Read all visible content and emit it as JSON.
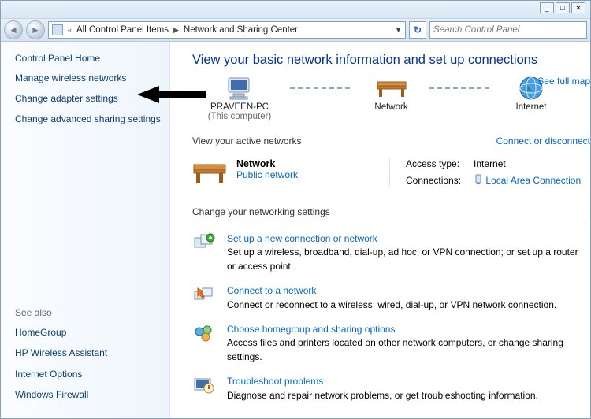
{
  "window_controls": {
    "min": "_",
    "max": "□",
    "close": "✕"
  },
  "breadcrumb": {
    "segment1": "All Control Panel Items",
    "segment2": "Network and Sharing Center"
  },
  "search": {
    "placeholder": "Search Control Panel"
  },
  "sidebar": {
    "home": "Control Panel Home",
    "links": [
      "Manage wireless networks",
      "Change adapter settings",
      "Change advanced sharing settings"
    ],
    "see_also_heading": "See also",
    "see_also": [
      "HomeGroup",
      "HP Wireless Assistant",
      "Internet Options",
      "Windows Firewall"
    ]
  },
  "main": {
    "title": "View your basic network information and set up connections",
    "full_map": "See full map",
    "nodes": {
      "computer": "PRAVEEN-PC",
      "computer_sub": "(This computer)",
      "network": "Network",
      "internet": "Internet"
    },
    "active_hdr": "View your active networks",
    "connect_link": "Connect or disconnect",
    "active": {
      "name": "Network",
      "type": "Public network",
      "access_label": "Access type:",
      "access_value": "Internet",
      "conn_label": "Connections:",
      "conn_value": "Local Area Connection"
    },
    "settings_hdr": "Change your networking settings",
    "tasks": [
      {
        "title": "Set up a new connection or network",
        "desc": "Set up a wireless, broadband, dial-up, ad hoc, or VPN connection; or set up a router or access point."
      },
      {
        "title": "Connect to a network",
        "desc": "Connect or reconnect to a wireless, wired, dial-up, or VPN network connection."
      },
      {
        "title": "Choose homegroup and sharing options",
        "desc": "Access files and printers located on other network computers, or change sharing settings."
      },
      {
        "title": "Troubleshoot problems",
        "desc": "Diagnose and repair network problems, or get troubleshooting information."
      }
    ]
  }
}
